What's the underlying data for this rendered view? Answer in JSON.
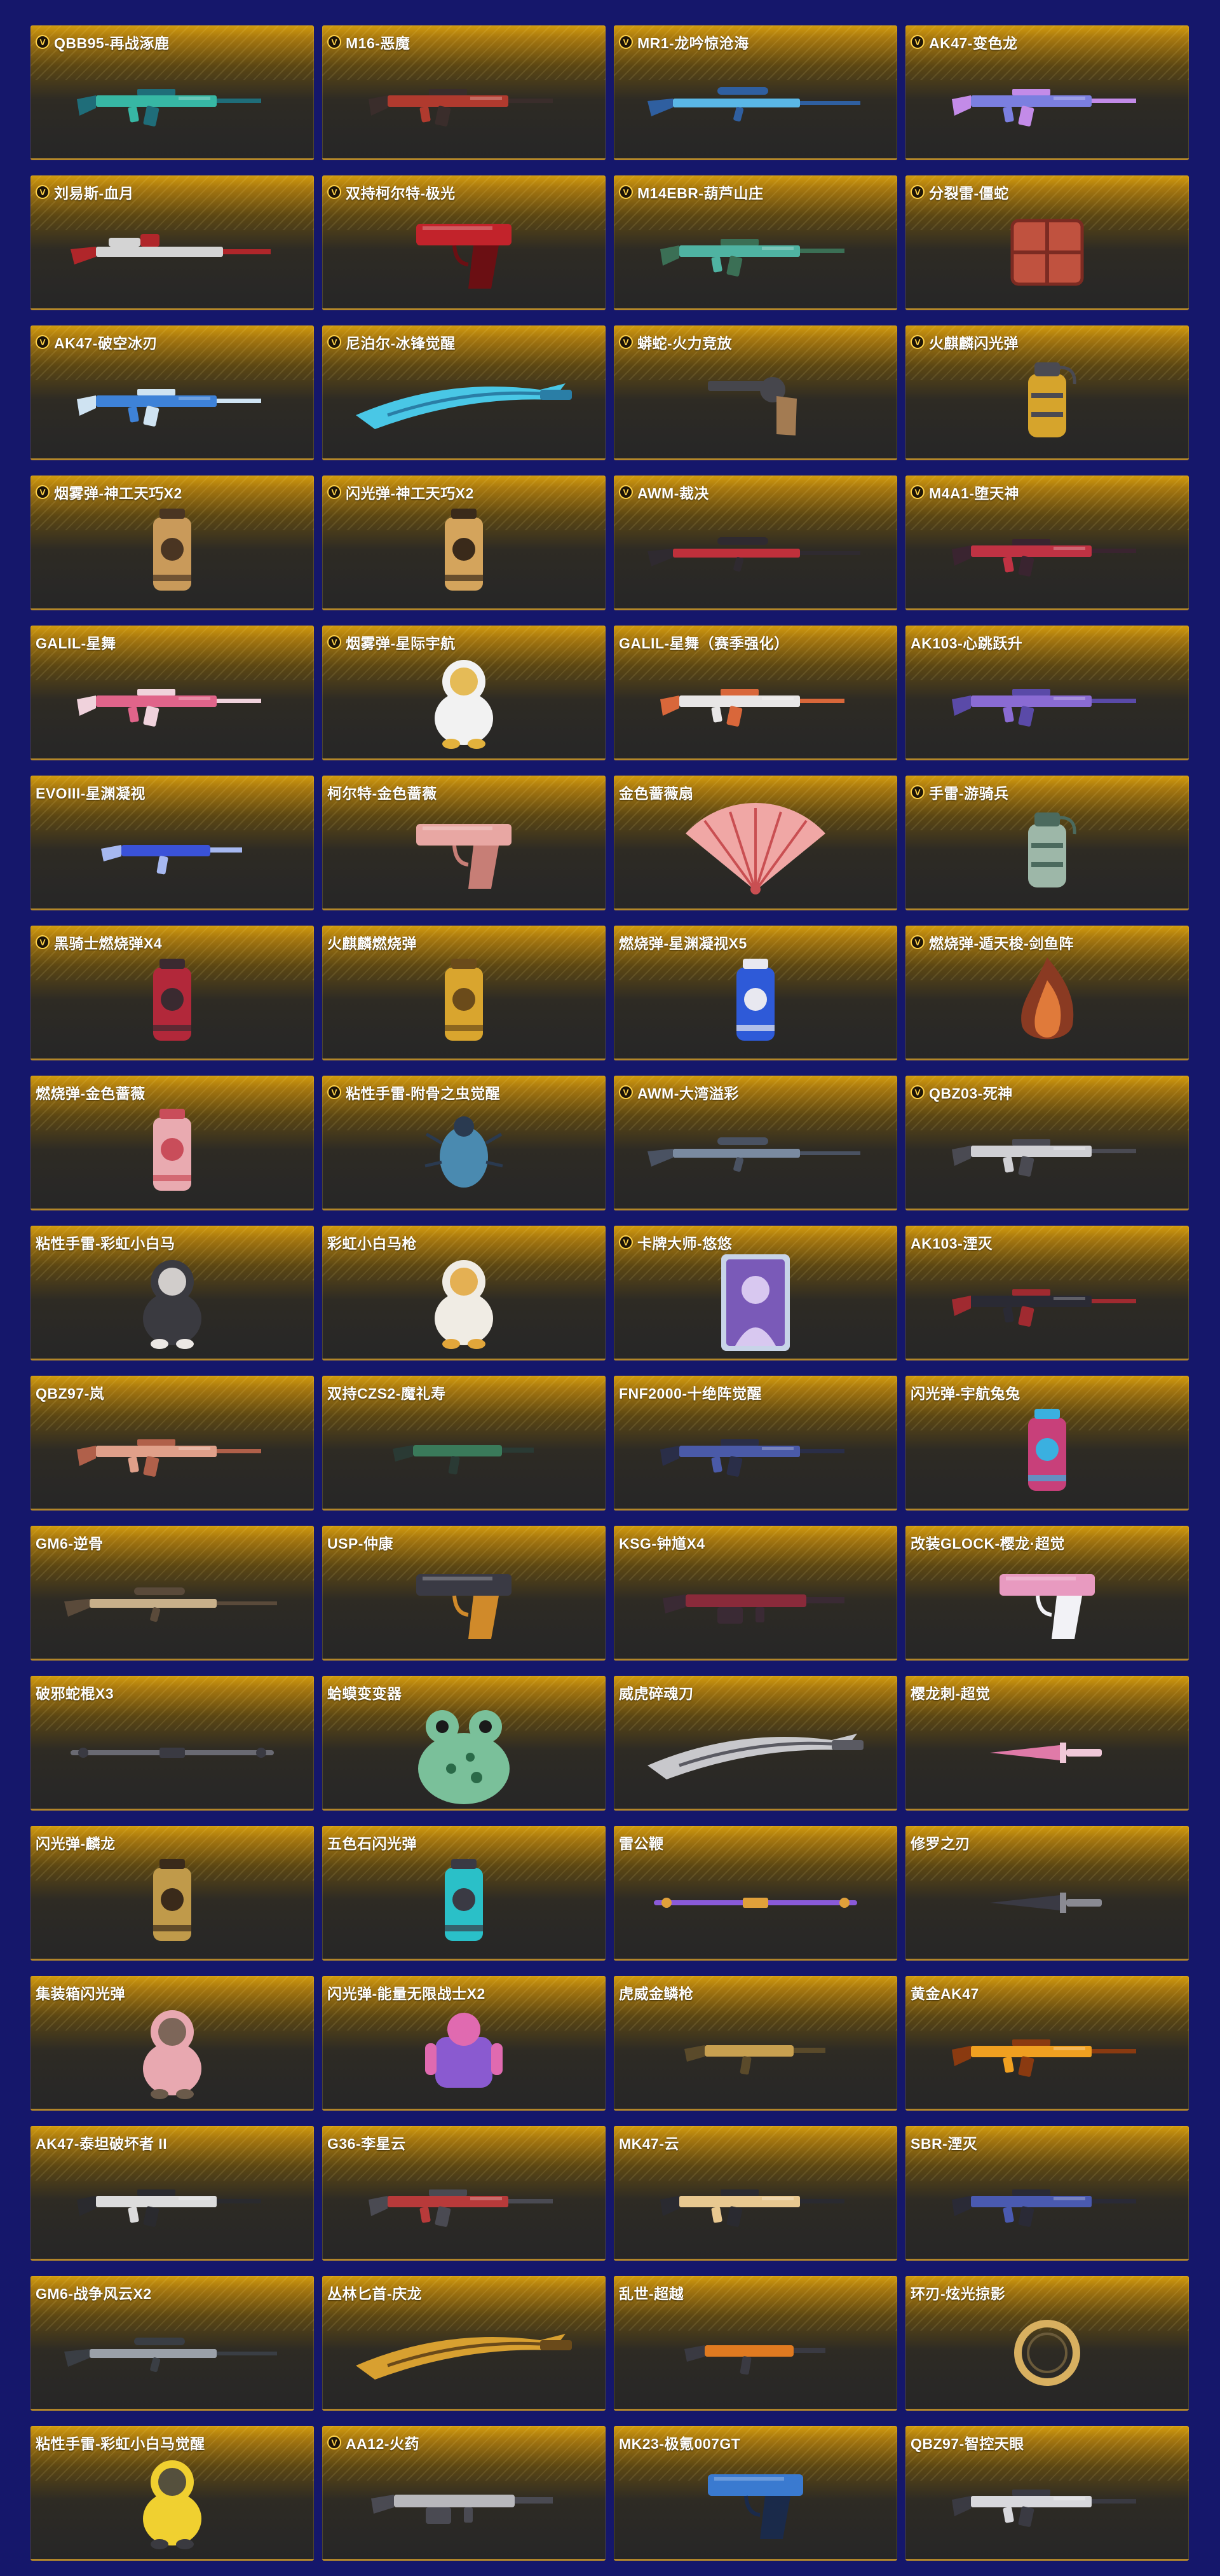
{
  "items": [
    {
      "name": "QBB95-再战涿鹿",
      "badge": true,
      "icon": "rifle-icon",
      "colors": [
        "#37b7a4",
        "#1f6d79"
      ]
    },
    {
      "name": "M16-恶魔",
      "badge": true,
      "icon": "rifle-icon",
      "colors": [
        "#b03a2e",
        "#3a2d2b"
      ]
    },
    {
      "name": "MR1-龙吟惊沧海",
      "badge": true,
      "icon": "sniper-icon",
      "colors": [
        "#5ab7e6",
        "#2f5fa0"
      ]
    },
    {
      "name": "AK47-变色龙",
      "badge": true,
      "icon": "rifle-icon",
      "colors": [
        "#7b7fe0",
        "#c38be8"
      ]
    },
    {
      "name": "刘易斯-血月",
      "badge": true,
      "icon": "machinegun-icon",
      "colors": [
        "#d4d4d4",
        "#b0262a"
      ]
    },
    {
      "name": "双持柯尔特-极光",
      "badge": true,
      "icon": "pistol-icon",
      "colors": [
        "#c2232b",
        "#6b0f13"
      ]
    },
    {
      "name": "M14EBR-葫芦山庄",
      "badge": true,
      "icon": "rifle-icon",
      "colors": [
        "#4fb3a2",
        "#3b6f55"
      ]
    },
    {
      "name": "分裂雷-僵蛇",
      "badge": true,
      "icon": "crate-icon",
      "colors": [
        "#c0523f",
        "#7c2b22"
      ]
    },
    {
      "name": "AK47-破空冰刃",
      "badge": true,
      "icon": "rifle-icon",
      "colors": [
        "#3e82d8",
        "#cfe3f2"
      ]
    },
    {
      "name": "尼泊尔-冰锋觉醒",
      "badge": true,
      "icon": "blade-icon",
      "colors": [
        "#49c7e6",
        "#2a7ea6"
      ]
    },
    {
      "name": "蟒蛇-火力竞放",
      "badge": true,
      "icon": "revolver-icon",
      "colors": [
        "#46464c",
        "#a37b52"
      ]
    },
    {
      "name": "火麒麟闪光弹",
      "badge": true,
      "icon": "grenade-icon",
      "colors": [
        "#d6a42c",
        "#4a4a52"
      ]
    },
    {
      "name": "烟雾弹-神工天巧X2",
      "badge": true,
      "icon": "canister-icon",
      "colors": [
        "#c99a5a",
        "#4a3522"
      ]
    },
    {
      "name": "闪光弹-神工天巧X2",
      "badge": true,
      "icon": "canister-icon",
      "colors": [
        "#d4a45c",
        "#3a2a1a"
      ]
    },
    {
      "name": "AWM-裁决",
      "badge": true,
      "icon": "sniper-icon",
      "colors": [
        "#c0303b",
        "#2f2a30"
      ]
    },
    {
      "name": "M4A1-堕天神",
      "badge": true,
      "icon": "rifle-icon",
      "colors": [
        "#c03243",
        "#3a2430"
      ]
    },
    {
      "name": "GALIL-星舞",
      "badge": false,
      "icon": "rifle-icon",
      "colors": [
        "#e0648a",
        "#f0d2dc"
      ]
    },
    {
      "name": "烟雾弹-星际宇航",
      "badge": true,
      "icon": "figure-icon",
      "colors": [
        "#f2f2f2",
        "#e3b23c"
      ]
    },
    {
      "name": "GALIL-星舞（赛季强化）",
      "badge": false,
      "icon": "rifle-icon",
      "colors": [
        "#e8e6e6",
        "#d9673a"
      ]
    },
    {
      "name": "AK103-心跳跃升",
      "badge": false,
      "icon": "rifle-icon",
      "colors": [
        "#8a6bd3",
        "#5a4aa8"
      ]
    },
    {
      "name": "EVOIII-星渊凝视",
      "badge": false,
      "icon": "smg-icon",
      "colors": [
        "#3a52d8",
        "#a6b8f0"
      ]
    },
    {
      "name": "柯尔特-金色蔷薇",
      "badge": false,
      "icon": "pistol-icon",
      "colors": [
        "#e8a7a3",
        "#c77e76"
      ]
    },
    {
      "name": "金色蔷薇扇",
      "badge": false,
      "icon": "fan-icon",
      "colors": [
        "#f0a7a5",
        "#c94f52"
      ]
    },
    {
      "name": "手雷-游骑兵",
      "badge": true,
      "icon": "grenade-icon",
      "colors": [
        "#9db7a8",
        "#4b6a5e"
      ]
    },
    {
      "name": "黑骑士燃烧弹X4",
      "badge": true,
      "icon": "canister-icon",
      "colors": [
        "#b2283a",
        "#3a2a30"
      ]
    },
    {
      "name": "火麒麟燃烧弹",
      "badge": false,
      "icon": "canister-icon",
      "colors": [
        "#d9a52e",
        "#6b4b1a"
      ]
    },
    {
      "name": "燃烧弹-星渊凝视X5",
      "badge": false,
      "icon": "canister-icon",
      "colors": [
        "#2e5ad8",
        "#e8e8f0"
      ]
    },
    {
      "name": "燃烧弹-遁天梭-剑鱼阵",
      "badge": true,
      "icon": "flame-icon",
      "colors": [
        "#e07a3a",
        "#8a3a22"
      ]
    },
    {
      "name": "燃烧弹-金色蔷薇",
      "badge": false,
      "icon": "canister-icon",
      "colors": [
        "#e9aab0",
        "#c94d5a"
      ]
    },
    {
      "name": "粘性手雷-附骨之虫觉醒",
      "badge": true,
      "icon": "beetle-icon",
      "colors": [
        "#4a8ab0",
        "#2a3a50"
      ]
    },
    {
      "name": "AWM-大湾溢彩",
      "badge": true,
      "icon": "sniper-icon",
      "colors": [
        "#7a8aa0",
        "#4a5262"
      ]
    },
    {
      "name": "QBZ03-死神",
      "badge": true,
      "icon": "rifle-icon",
      "colors": [
        "#d0d0d4",
        "#4a4a52"
      ]
    },
    {
      "name": "粘性手雷-彩虹小白马",
      "badge": false,
      "icon": "figure-icon",
      "colors": [
        "#3a3a40",
        "#ece8e4"
      ]
    },
    {
      "name": "彩虹小白马枪",
      "badge": false,
      "icon": "figure-icon",
      "colors": [
        "#f0ece4",
        "#e2a63a"
      ]
    },
    {
      "name": "卡牌大师-悠悠",
      "badge": true,
      "icon": "card-icon",
      "colors": [
        "#7a5ab8",
        "#d8c8f0"
      ]
    },
    {
      "name": "AK103-湮灭",
      "badge": false,
      "icon": "rifle-icon",
      "colors": [
        "#2a2a34",
        "#a02a30"
      ]
    },
    {
      "name": "QBZ97-岚",
      "badge": false,
      "icon": "rifle-icon",
      "colors": [
        "#e0a08a",
        "#b0604a"
      ]
    },
    {
      "name": "双持CZS2-魔礼寿",
      "badge": false,
      "icon": "smg-icon",
      "colors": [
        "#3a7a5a",
        "#2a3a34"
      ]
    },
    {
      "name": "FNF2000-十绝阵觉醒",
      "badge": false,
      "icon": "rifle-icon",
      "colors": [
        "#4a5aa8",
        "#2a2e48"
      ]
    },
    {
      "name": "闪光弹-宇航兔兔",
      "badge": false,
      "icon": "canister-icon",
      "colors": [
        "#c8407a",
        "#3ab0e0"
      ]
    },
    {
      "name": "GM6-逆骨",
      "badge": false,
      "icon": "sniper-icon",
      "colors": [
        "#c8b08a",
        "#5a4a3a"
      ]
    },
    {
      "name": "USP-仲康",
      "badge": false,
      "icon": "pistol-icon",
      "colors": [
        "#3a3a44",
        "#d08a2a"
      ]
    },
    {
      "name": "KSG-钟馗X4",
      "badge": false,
      "icon": "shotgun-icon",
      "colors": [
        "#8a2a3a",
        "#3a2a34"
      ]
    },
    {
      "name": "改装GLOCK-樱龙·超觉",
      "badge": false,
      "icon": "pistol-icon",
      "colors": [
        "#e89ac0",
        "#f2f2f6"
      ]
    },
    {
      "name": "破邪蛇棍X3",
      "badge": false,
      "icon": "staff-icon",
      "colors": [
        "#6a6a72",
        "#3a3a42"
      ]
    },
    {
      "name": "蛤蟆变变器",
      "badge": false,
      "icon": "frog-icon",
      "colors": [
        "#7ac09a",
        "#2a6a48"
      ]
    },
    {
      "name": "威虎碎魂刀",
      "badge": false,
      "icon": "blade-icon",
      "colors": [
        "#c8c8cc",
        "#5a5a62"
      ]
    },
    {
      "name": "樱龙刺-超觉",
      "badge": false,
      "icon": "dagger-icon",
      "colors": [
        "#e07aa8",
        "#f0c8d8"
      ]
    },
    {
      "name": "闪光弹-麟龙",
      "badge": false,
      "icon": "canister-icon",
      "colors": [
        "#c09a4a",
        "#3a2a1a"
      ]
    },
    {
      "name": "五色石闪光弹",
      "badge": false,
      "icon": "canister-icon",
      "colors": [
        "#2ac0c8",
        "#3a3a44"
      ]
    },
    {
      "name": "雷公鞭",
      "badge": false,
      "icon": "staff-icon",
      "colors": [
        "#8a5ad8",
        "#e0a03a"
      ]
    },
    {
      "name": "修罗之刃",
      "badge": false,
      "icon": "dagger-icon",
      "colors": [
        "#3a3a44",
        "#8a8a92"
      ]
    },
    {
      "name": "集装箱闪光弹",
      "badge": false,
      "icon": "figure-icon",
      "colors": [
        "#e8a8b0",
        "#6a5a4a"
      ]
    },
    {
      "name": "闪光弹-能量无限战士X2",
      "badge": false,
      "icon": "robot-icon",
      "colors": [
        "#8a5ad0",
        "#e06ab0"
      ]
    },
    {
      "name": "虎威金鳞枪",
      "badge": false,
      "icon": "smg-icon",
      "colors": [
        "#c8a050",
        "#5a4a2a"
      ]
    },
    {
      "name": "黄金AK47",
      "badge": false,
      "icon": "rifle-icon",
      "colors": [
        "#f0a020",
        "#8a3a10"
      ]
    },
    {
      "name": "AK47-泰坦破坏者 II",
      "badge": false,
      "icon": "rifle-icon",
      "colors": [
        "#dcdcdc",
        "#2a2a2e"
      ]
    },
    {
      "name": "G36-李星云",
      "badge": false,
      "icon": "rifle-icon",
      "colors": [
        "#b83a3a",
        "#4a4a52"
      ]
    },
    {
      "name": "MK47-云",
      "badge": false,
      "icon": "rifle-icon",
      "colors": [
        "#e8c890",
        "#2a2a30"
      ]
    },
    {
      "name": "SBR-湮灭",
      "badge": false,
      "icon": "rifle-icon",
      "colors": [
        "#4a5ab0",
        "#2a2a36"
      ]
    },
    {
      "name": "GM6-战争风云X2",
      "badge": false,
      "icon": "sniper-icon",
      "colors": [
        "#9aa0a8",
        "#3a3e44"
      ]
    },
    {
      "name": "丛林匕首-庆龙",
      "badge": false,
      "icon": "blade-icon",
      "colors": [
        "#d8a030",
        "#6a4a1a"
      ]
    },
    {
      "name": "乱世-超越",
      "badge": false,
      "icon": "smg-icon",
      "colors": [
        "#e07a20",
        "#3a3a42"
      ]
    },
    {
      "name": "环刃-炫光掠影",
      "badge": false,
      "icon": "ring-blade-icon",
      "colors": [
        "#d8b060",
        "#6a5a3a"
      ]
    },
    {
      "name": "粘性手雷-彩虹小白马觉醒",
      "badge": false,
      "icon": "figure-icon",
      "colors": [
        "#f0d030",
        "#3a3a40"
      ]
    },
    {
      "name": "AA12-火药",
      "badge": true,
      "icon": "shotgun-icon",
      "colors": [
        "#b8b8bc",
        "#4a4a52"
      ]
    },
    {
      "name": "MK23-极氪007GT",
      "badge": false,
      "icon": "pistol-icon",
      "colors": [
        "#3a7ad0",
        "#1a2a4a"
      ]
    },
    {
      "name": "QBZ97-智控天眼",
      "badge": false,
      "icon": "rifle-icon",
      "colors": [
        "#d8d8dc",
        "#3a3a42"
      ]
    }
  ]
}
